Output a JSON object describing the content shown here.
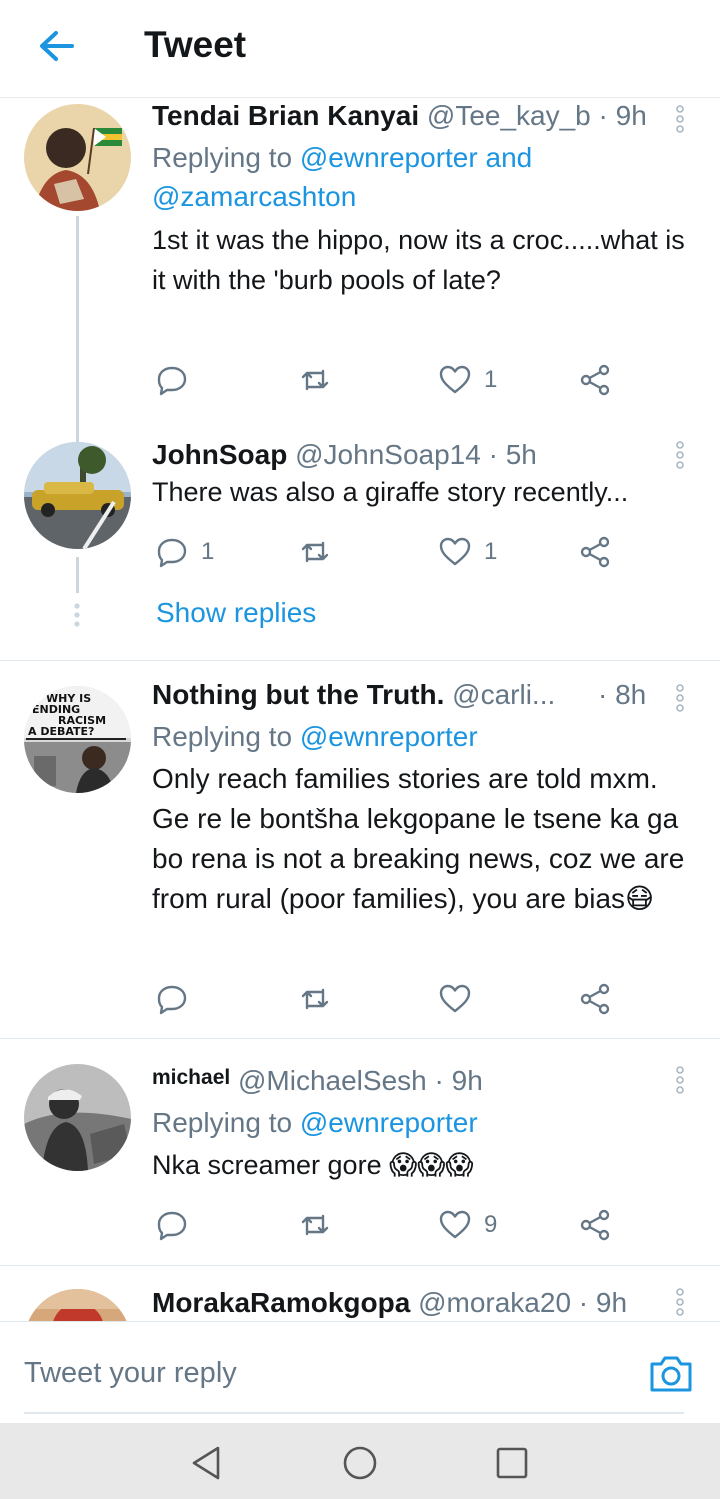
{
  "header": {
    "title": "Tweet"
  },
  "tweets": [
    {
      "name": "Tendai Brian Kanyai",
      "handle": "@Tee_kay_b",
      "time": "· 9h",
      "replying_prefix": "Replying to ",
      "replying_links": [
        "@ewnreporter",
        " and",
        "@zamarcashton"
      ],
      "text": "1st it was the hippo,  now its a croc.....what is it with the 'burb pools of late?",
      "reply_count": "",
      "like_count": "1"
    },
    {
      "name": "JohnSoap",
      "handle": "@JohnSoap14",
      "time": "· 5h",
      "text": "There was also a giraffe story recently...",
      "reply_count": "1",
      "like_count": "1"
    },
    {
      "name": "Nothing but the Truth.",
      "handle": "@carli...",
      "time": "· 8h",
      "replying_prefix": "Replying to ",
      "replying_link": "@ewnreporter",
      "text": "Only reach families stories are told mxm. Ge re le bontšha lekgopane le tsene ka ga bo rena is not a breaking news, coz we are from rural (poor families), you are bias😷",
      "avatar_sign": [
        "WHY IS",
        "ENDING",
        "RACISM",
        "A DEBATE?"
      ]
    },
    {
      "name": "michael",
      "handle": "@MichaelSesh",
      "time": "· 9h",
      "replying_prefix": "Replying to ",
      "replying_link": "@ewnreporter",
      "text": "Nka screamer gore 😱😱😱",
      "like_count": "9"
    },
    {
      "name": "MorakaRamokgopa",
      "handle": "@moraka20",
      "time": "· 9h"
    }
  ],
  "show_replies": "Show replies",
  "reply_bar": {
    "placeholder": "Tweet your reply"
  },
  "colors": {
    "accent": "#1b95e0",
    "muted": "#657786",
    "text": "#14171a"
  }
}
